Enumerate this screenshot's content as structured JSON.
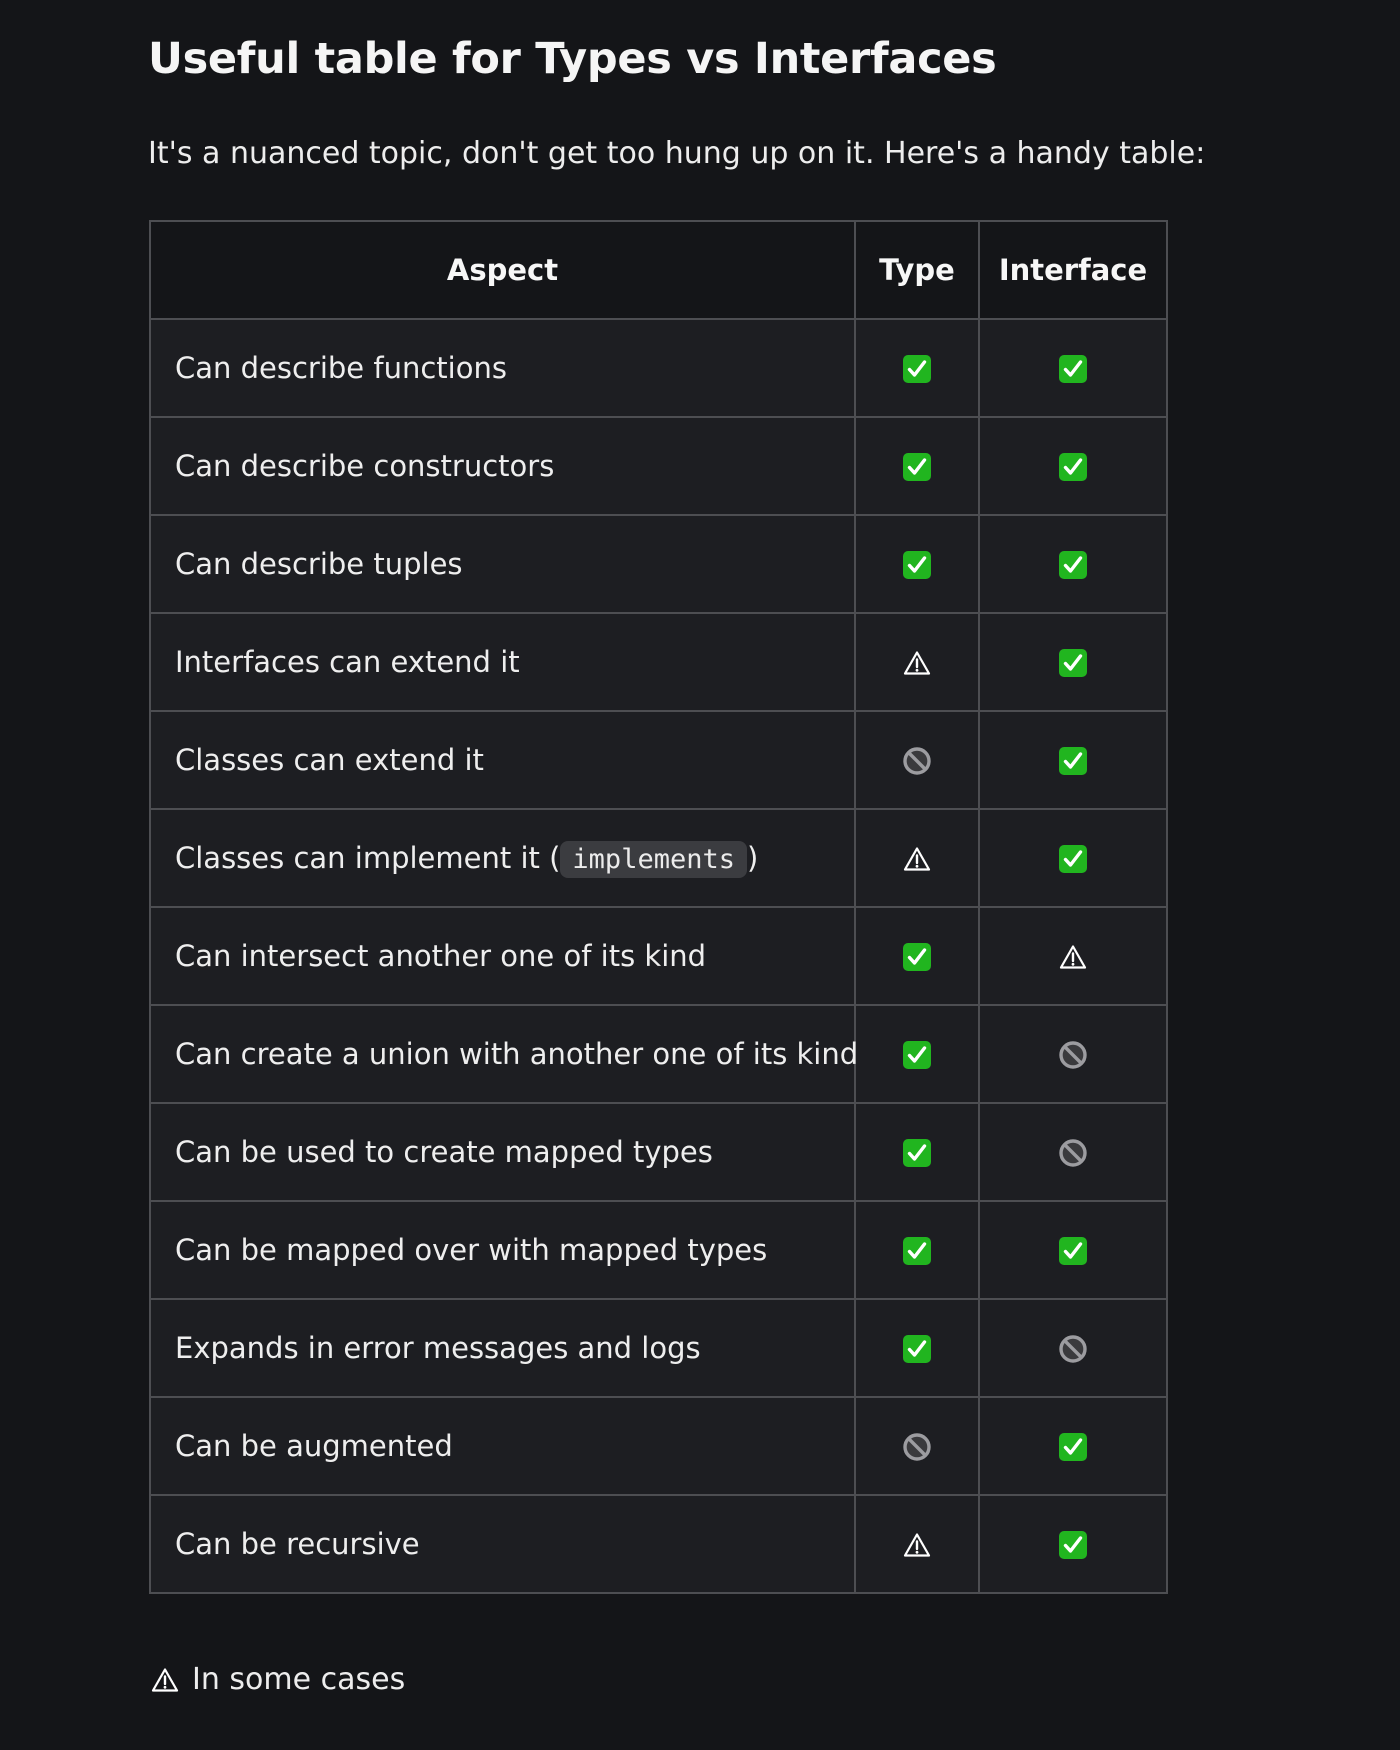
{
  "title": "Useful table for Types vs Interfaces",
  "intro": "It's a nuanced topic, don't get too hung up on it. Here's a handy table:",
  "table": {
    "headers": [
      "Aspect",
      "Type",
      "Interface"
    ],
    "rows": [
      {
        "aspect": "Can describe functions",
        "type": "check-icon",
        "interface": "check-icon"
      },
      {
        "aspect": "Can describe constructors",
        "type": "check-icon",
        "interface": "check-icon"
      },
      {
        "aspect": "Can describe tuples",
        "type": "check-icon",
        "interface": "check-icon"
      },
      {
        "aspect": "Interfaces can extend it",
        "type": "warning-icon",
        "interface": "check-icon"
      },
      {
        "aspect": "Classes can extend it",
        "type": "prohibited-icon",
        "interface": "check-icon"
      },
      {
        "aspect": "Classes can implement it (",
        "code": "implements",
        "aspect_suffix": ")",
        "type": "warning-icon",
        "interface": "check-icon"
      },
      {
        "aspect": "Can intersect another one of its kind",
        "type": "check-icon",
        "interface": "warning-icon"
      },
      {
        "aspect": "Can create a union with another one of its kind",
        "type": "check-icon",
        "interface": "prohibited-icon"
      },
      {
        "aspect": "Can be used to create mapped types",
        "type": "check-icon",
        "interface": "prohibited-icon"
      },
      {
        "aspect": "Can be mapped over with mapped types",
        "type": "check-icon",
        "interface": "check-icon"
      },
      {
        "aspect": "Expands in error messages and logs",
        "type": "check-icon",
        "interface": "prohibited-icon"
      },
      {
        "aspect": "Can be augmented",
        "type": "prohibited-icon",
        "interface": "check-icon"
      },
      {
        "aspect": "Can be recursive",
        "type": "warning-icon",
        "interface": "check-icon"
      }
    ]
  },
  "footnote": {
    "icon": "warning-icon",
    "text": "In some cases"
  },
  "colors": {
    "background": "#141518",
    "row_background": "#1d1e22",
    "border": "#4d4e52",
    "check_green": "#21b51f",
    "code_background": "#3b3c40"
  }
}
